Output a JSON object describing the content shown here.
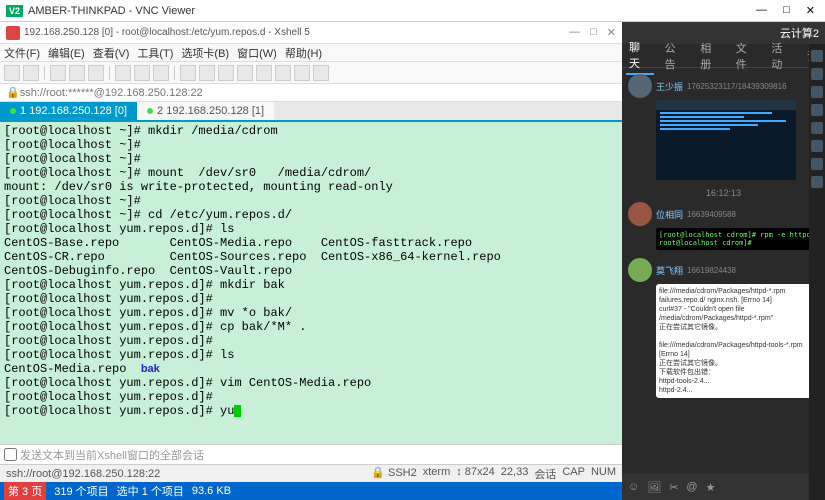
{
  "vnc": {
    "title": "AMBER-THINKPAD - VNC Viewer"
  },
  "xshell": {
    "title": "192.168.250.128 [0] - root@localhost:/etc/yum.repos.d - Xshell 5",
    "menu": [
      "文件(F)",
      "编辑(E)",
      "查看(V)",
      "工具(T)",
      "选项卡(B)",
      "窗口(W)",
      "帮助(H)"
    ],
    "addr": "ssh://root:******@192.168.250.128:22",
    "tabs": [
      {
        "label": "1 192.168.250.128 [0]",
        "active": true
      },
      {
        "label": "2 192.168.250.128 [1]",
        "active": false
      }
    ],
    "term_lines": [
      {
        "t": "[root@localhost ~]# mkdir /media/cdrom"
      },
      {
        "t": "[root@localhost ~]#"
      },
      {
        "t": "[root@localhost ~]#"
      },
      {
        "t": "[root@localhost ~]# mount  /dev/sr0   /media/cdrom/"
      },
      {
        "t": "mount: /dev/sr0 is write-protected, mounting read-only"
      },
      {
        "t": "[root@localhost ~]#"
      },
      {
        "t": "[root@localhost ~]# cd /etc/yum.repos.d/"
      },
      {
        "t": "[root@localhost yum.repos.d]# ls"
      },
      {
        "t": "CentOS-Base.repo       CentOS-Media.repo    CentOS-fasttrack.repo"
      },
      {
        "t": "CentOS-CR.repo         CentOS-Sources.repo  CentOS-x86_64-kernel.repo"
      },
      {
        "t": "CentOS-Debuginfo.repo  CentOS-Vault.repo"
      },
      {
        "t": "[root@localhost yum.repos.d]# mkdir bak"
      },
      {
        "t": "[root@localhost yum.repos.d]#"
      },
      {
        "t": "[root@localhost yum.repos.d]# mv *o bak/"
      },
      {
        "t": "[root@localhost yum.repos.d]# cp bak/*M* ."
      },
      {
        "t": "[root@localhost yum.repos.d]#"
      },
      {
        "t": "[root@localhost yum.repos.d]# ls"
      },
      {
        "t": "CentOS-Media.repo  ",
        "blue": "bak"
      },
      {
        "t": "[root@localhost yum.repos.d]# vim CentOS-Media.repo"
      },
      {
        "t": "[root@localhost yum.repos.d]#"
      },
      {
        "t": "[root@localhost yum.repos.d]# yu",
        "cursor": true
      }
    ],
    "input_hint": "发送文本到当前Xshell窗口的全部会话",
    "status": {
      "left": "ssh://root@192.168.250.128:22",
      "ssh": "SSH2",
      "term": "xterm",
      "size": "87x24",
      "rc": "22,33",
      "sess": "会话",
      "cap": "CAP",
      "num": "NUM"
    },
    "explorer": {
      "page": "第 3 页",
      "items": "319 个项目",
      "sel": "选中 1 个项目",
      "size": "93.6 KB"
    }
  },
  "side": {
    "room": "云计算2",
    "tabs": [
      "聊天",
      "公告",
      "相册",
      "文件",
      "活动",
      "设"
    ],
    "active_tab": "聊天",
    "ts1": "16:12:13",
    "users": [
      {
        "name": "王少振",
        "id": "17625323117/18439309816"
      },
      {
        "name": "位相同",
        "id": "16639409588"
      },
      {
        "name": "莫飞翔",
        "id": "16619824438"
      }
    ],
    "snippet": "[root@localhost cdrom]# rpm -e httpd\nroot@localhost cdrom]# "
  }
}
